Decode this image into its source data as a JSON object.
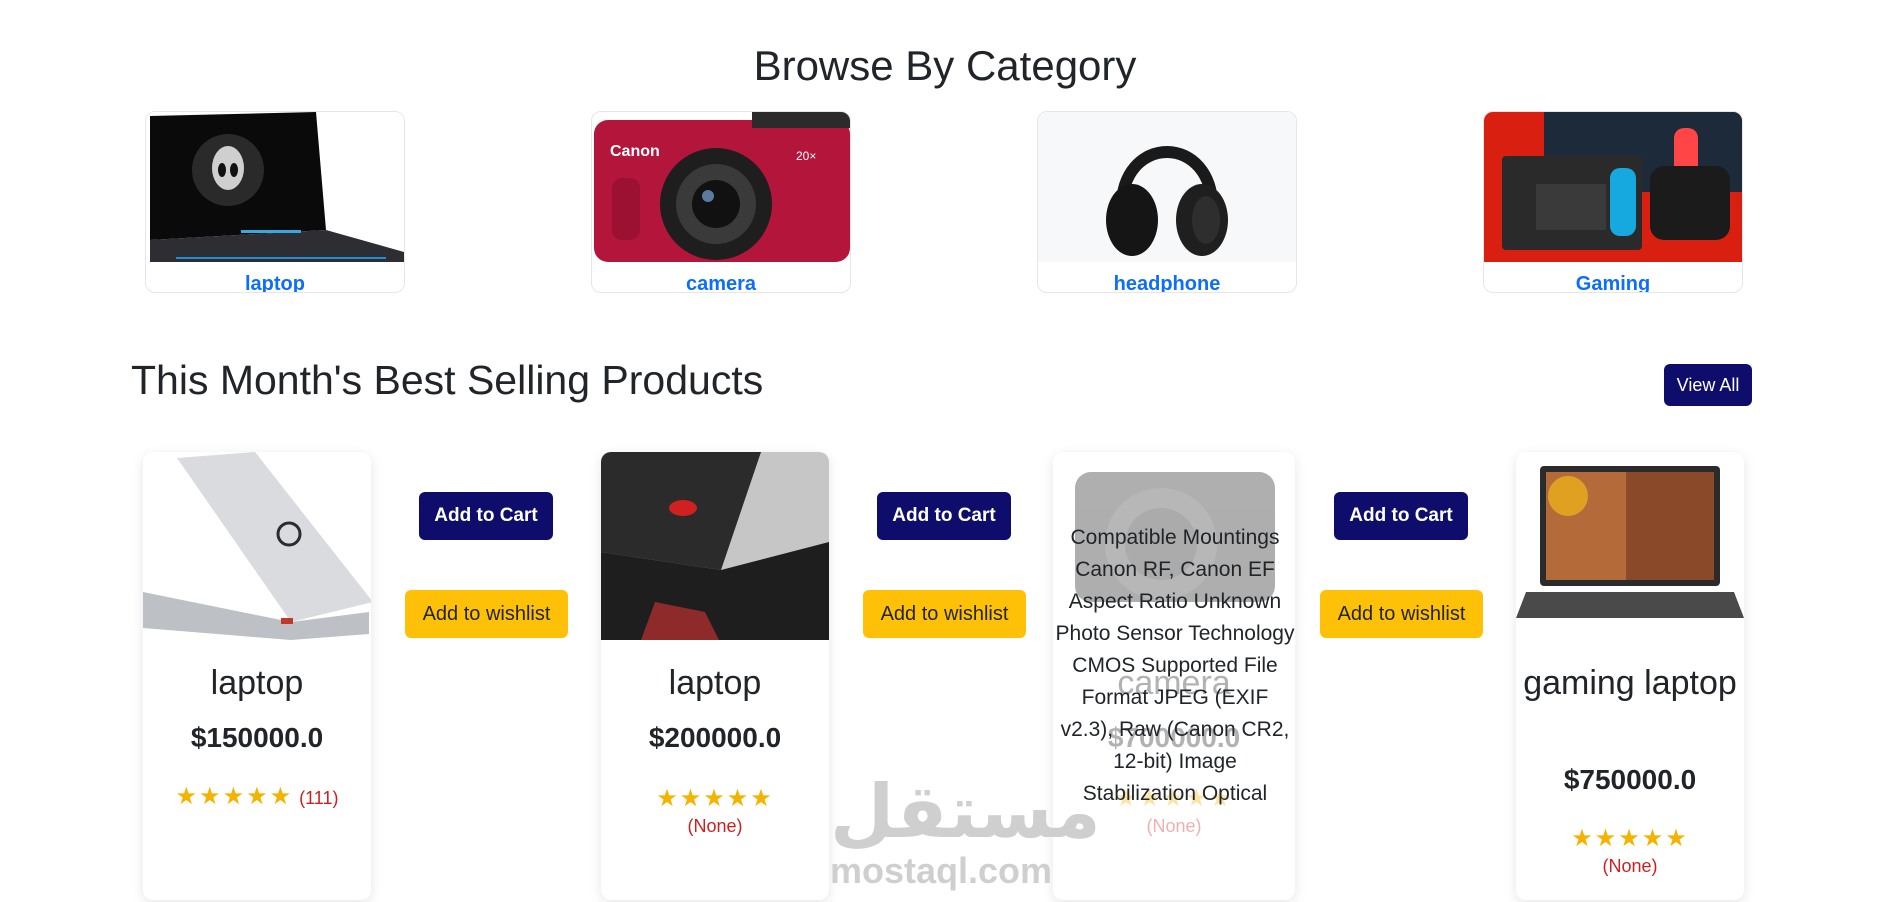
{
  "browse": {
    "title": "Browse By Category",
    "categories": [
      {
        "label": "laptop"
      },
      {
        "label": "camera"
      },
      {
        "label": "headphone"
      },
      {
        "label": "Gaming"
      }
    ]
  },
  "best": {
    "title": "This Month's Best Selling Products",
    "view_all": "View All"
  },
  "products": [
    {
      "name": "laptop",
      "price": "$150000.0",
      "stars": "★★★★★",
      "rating_count": "(111)"
    },
    {
      "name": "laptop",
      "price": "$200000.0",
      "stars": "★★★★★",
      "rating_count": "(None)"
    },
    {
      "name": "camera",
      "price": "$700000.0",
      "stars": "★★★★★",
      "rating_count": "(None)",
      "description": "Compatible Mountings Canon RF, Canon EF Aspect Ratio Unknown Photo Sensor Technology CMOS Supported File Format JPEG (EXIF v2.3), Raw (Canon CR2, 12-bit) Image Stabilization Optical"
    },
    {
      "name": "gaming laptop",
      "price": "$750000.0",
      "stars": "★★★★★",
      "rating_count": "(None)"
    }
  ],
  "actions": {
    "add_to_cart": "Add to Cart",
    "add_to_wishlist": "Add to wishlist"
  },
  "watermark": {
    "arabic": "مستقل",
    "latin": "mostaql.com"
  }
}
